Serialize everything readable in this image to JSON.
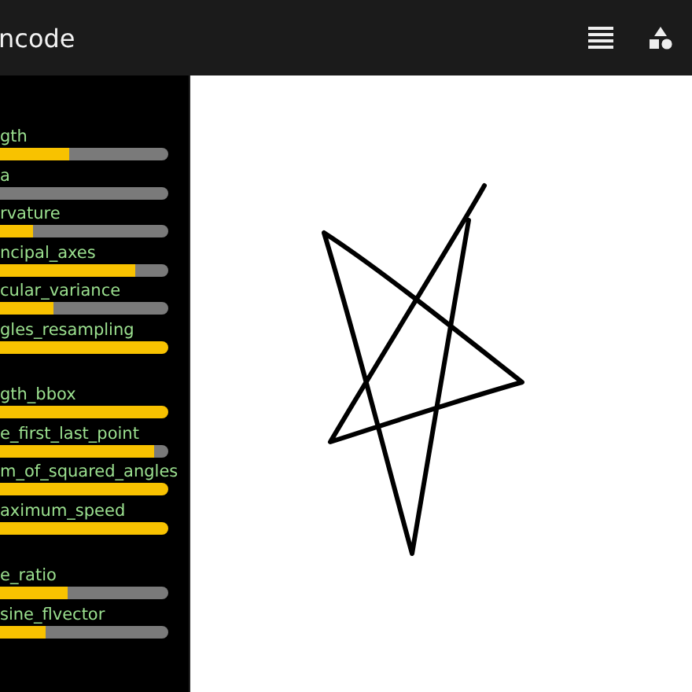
{
  "app_bar": {
    "title": "ncode"
  },
  "feature_groups": [
    {
      "features": [
        {
          "label": "gth",
          "level": 0.41
        },
        {
          "label": "a",
          "level": 0
        },
        {
          "label": "rvature",
          "level": 0.2
        },
        {
          "label": "ncipal_axes",
          "level": 0.8
        },
        {
          "label": "cular_variance",
          "level": 0.32
        },
        {
          "label": "gles_resampling",
          "level": 1
        }
      ]
    },
    {
      "features": [
        {
          "label": "gth_bbox",
          "level": 1
        },
        {
          "label": "e_first_last_point",
          "level": 0.92
        },
        {
          "label": "m_of_squared_angles",
          "level": 1
        },
        {
          "label": "aximum_speed",
          "level": 1
        }
      ]
    },
    {
      "features": [
        {
          "label": "e_ratio",
          "level": 0.4
        },
        {
          "label": "sine_flvector",
          "level": 0.27
        }
      ]
    }
  ]
}
